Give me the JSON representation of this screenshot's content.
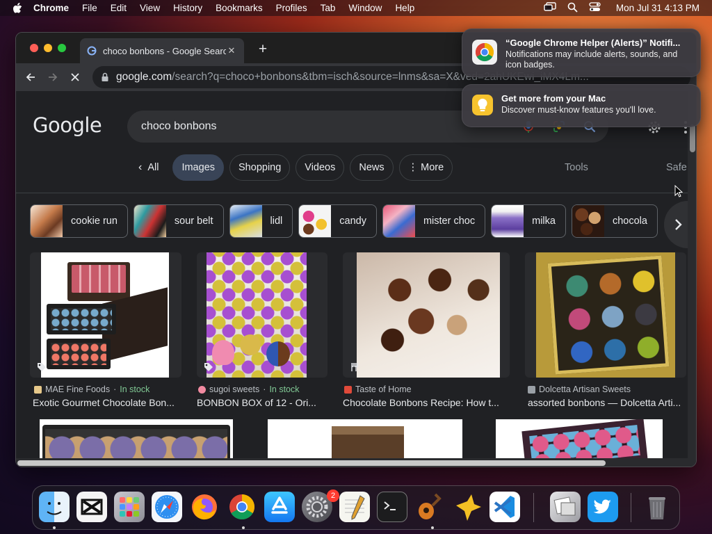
{
  "menubar": {
    "app_name": "Chrome",
    "items": [
      "File",
      "Edit",
      "View",
      "History",
      "Bookmarks",
      "Profiles",
      "Tab",
      "Window",
      "Help"
    ],
    "clock": "Mon Jul 31  4:13 PM"
  },
  "browser": {
    "tab_title": "choco bonbons - Google Search",
    "url_domain": "google.com",
    "url_path": "/search?q=choco+bonbons&tbm=isch&source=lnms&sa=X&ved=2ahUKEwi_iMX4Lm..."
  },
  "google": {
    "logo_text": "Google",
    "query": "choco bonbons",
    "filters": {
      "all": "All",
      "images": "Images",
      "shopping": "Shopping",
      "videos": "Videos",
      "news": "News",
      "more": "More"
    },
    "tools": "Tools",
    "safe": "Safe",
    "related": [
      "cookie run",
      "sour belt",
      "lidl",
      "candy",
      "mister choc",
      "milka",
      "chocola"
    ],
    "results": [
      {
        "source": "MAE Fine Foods",
        "stock": "In stock",
        "title": "Exotic Gourmet Chocolate Bon..."
      },
      {
        "source": "sugoi sweets",
        "stock": "In stock",
        "title": "BONBON BOX of 12 - Ori..."
      },
      {
        "source": "Taste of Home",
        "stock": "",
        "title": "Chocolate Bonbons Recipe: How t..."
      },
      {
        "source": "Dolcetta Artisan Sweets",
        "stock": "",
        "title": "assorted bonbons — Dolcetta Arti..."
      }
    ],
    "stock_separator": "·"
  },
  "notifications": [
    {
      "title": "“Google Chrome Helper (Alerts)” Notifi...",
      "body": "Notifications may include alerts, sounds, and icon badges."
    },
    {
      "title": "Get more from your Mac",
      "body": "Discover must-know features you'll love."
    }
  ],
  "dock": {
    "settings_badge": "2"
  }
}
